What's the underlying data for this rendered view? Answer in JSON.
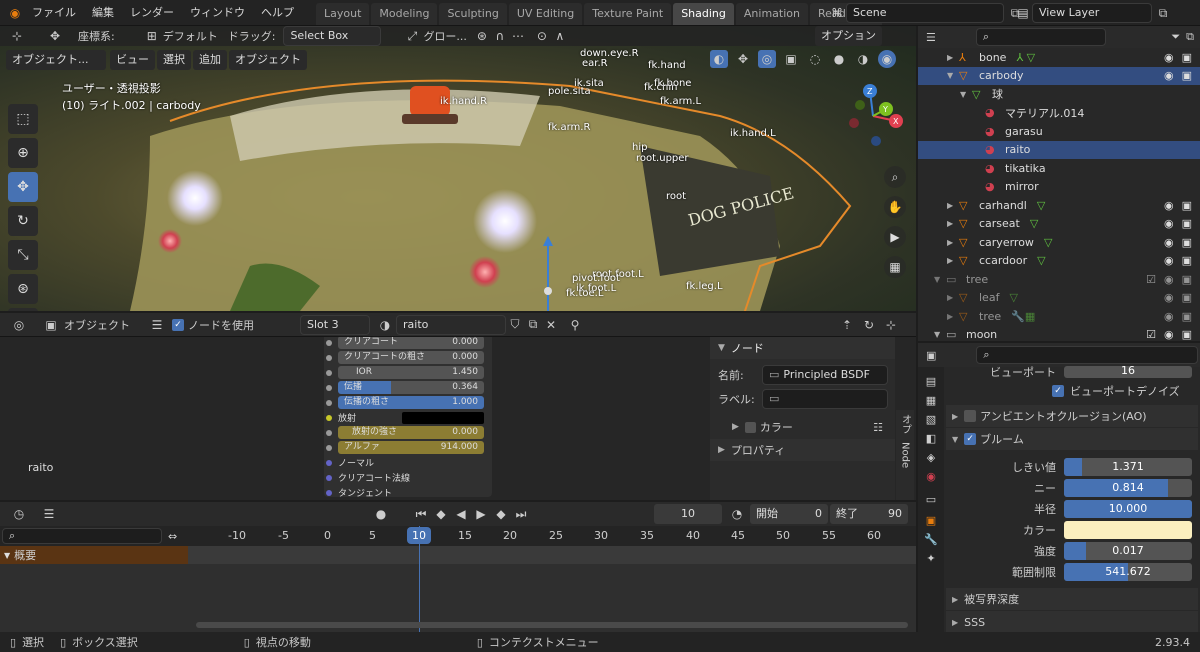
{
  "menu": [
    "ファイル",
    "編集",
    "レンダー",
    "ウィンドウ",
    "ヘルプ"
  ],
  "workspaces": [
    "Layout",
    "Modeling",
    "Sculpting",
    "UV Editing",
    "Texture Paint",
    "Shading",
    "Animation",
    "Rendering"
  ],
  "active_workspace": "Shading",
  "scene": "Scene",
  "view_layer": "View Layer",
  "viewport": {
    "coord_label": "座標系:",
    "coord_value": "デフォルト",
    "drag_label": "ドラッグ:",
    "drag_value": "Select Box",
    "global": "グロー...",
    "options": "オプション",
    "mode": "オブジェクト...",
    "menus": [
      "ビュー",
      "選択",
      "追加",
      "オブジェクト"
    ],
    "view_name": "ユーザー・透視投影",
    "info": "(10) ライト.002 | carbody",
    "bones": [
      "ik.hand.R",
      "pole.sita",
      "ik.sita",
      "fk.arm.R",
      "fk.arm.L",
      "ik.hand.L",
      "hip",
      "root.upper",
      "root",
      "down.eye.R",
      "ear.R",
      "fk.hand",
      "fk.chin",
      "fk.bone",
      "root.foot.L",
      "pivot.foot",
      "ik.foot.L",
      "fk.toe.L",
      "fk.leg.L"
    ],
    "decal": "DOG POLICE"
  },
  "node_editor": {
    "mode": "オブジェクト",
    "use_nodes": "ノードを使用",
    "slot": "Slot 3",
    "material": "raito",
    "frame_label": "raito",
    "rows": [
      {
        "label": "クリアコート",
        "value": "0.000",
        "kind": "gray"
      },
      {
        "label": "クリアコートの粗さ",
        "value": "0.000",
        "kind": "gray"
      },
      {
        "label": "IOR",
        "value": "1.450",
        "kind": "gray"
      },
      {
        "label": "伝播",
        "value": "0.364",
        "kind": "blue",
        "fill": 0.364
      },
      {
        "label": "伝播の粗さ",
        "value": "1.000",
        "kind": "blue",
        "fill": 1.0
      },
      {
        "label": "放射",
        "value": "",
        "kind": "color"
      },
      {
        "label": "放射の強さ",
        "value": "0.000",
        "kind": "gold"
      },
      {
        "label": "アルファ",
        "value": "914.000",
        "kind": "gold"
      },
      {
        "label": "ノーマル",
        "value": "",
        "kind": "socket"
      },
      {
        "label": "クリアコート法線",
        "value": "",
        "kind": "socket"
      },
      {
        "label": "タンジェント",
        "value": "",
        "kind": "socket"
      }
    ],
    "npanel": {
      "header": "ノード",
      "name_label": "名前:",
      "name_value": "Principled BSDF",
      "label_label": "ラベル:",
      "color": "カラー",
      "properties": "プロパティ",
      "tabs": [
        "オプ",
        "Node"
      ]
    }
  },
  "timeline": {
    "current": "10",
    "start_label": "開始",
    "start": "0",
    "end_label": "終了",
    "end": "90",
    "ticks": [
      "-10",
      "-5",
      "0",
      "5",
      "10",
      "15",
      "20",
      "25",
      "30",
      "35",
      "40",
      "45",
      "50",
      "55",
      "60"
    ],
    "summary": "概要"
  },
  "outliner": {
    "rows": [
      {
        "indent": 3,
        "name": "bone",
        "icon": "armature",
        "sel": false,
        "extra": "bone-icons"
      },
      {
        "indent": 3,
        "name": "carbody",
        "icon": "mesh",
        "sel": true,
        "extra": ""
      },
      {
        "indent": 4,
        "name": "球",
        "icon": "mesh-data",
        "sel": false,
        "extra": ""
      },
      {
        "indent": 5,
        "name": "マテリアル.014",
        "icon": "material",
        "sel": false,
        "extra": ""
      },
      {
        "indent": 5,
        "name": "garasu",
        "icon": "material",
        "sel": false,
        "extra": ""
      },
      {
        "indent": 5,
        "name": "raito",
        "icon": "material",
        "sel": true,
        "extra": ""
      },
      {
        "indent": 5,
        "name": "tikatika",
        "icon": "material",
        "sel": false,
        "extra": ""
      },
      {
        "indent": 5,
        "name": "mirror",
        "icon": "material",
        "sel": false,
        "extra": ""
      },
      {
        "indent": 3,
        "name": "carhandl",
        "icon": "mesh",
        "sel": false,
        "extra": "v"
      },
      {
        "indent": 3,
        "name": "carseat",
        "icon": "mesh",
        "sel": false,
        "extra": "v"
      },
      {
        "indent": 3,
        "name": "caryerrow",
        "icon": "mesh",
        "sel": false,
        "extra": "v"
      },
      {
        "indent": 3,
        "name": "ccardoor",
        "icon": "mesh",
        "sel": false,
        "extra": "v"
      },
      {
        "indent": 2,
        "name": "tree",
        "icon": "collection",
        "sel": false,
        "extra": "",
        "dim": true
      },
      {
        "indent": 3,
        "name": "leaf",
        "icon": "mesh",
        "sel": false,
        "extra": "v",
        "dim": true
      },
      {
        "indent": 3,
        "name": "tree",
        "icon": "mesh",
        "sel": false,
        "extra": "mods",
        "dim": true
      },
      {
        "indent": 2,
        "name": "moon",
        "icon": "collection",
        "sel": false,
        "extra": ""
      }
    ]
  },
  "properties": {
    "viewport_label": "ビューポート",
    "viewport_value": "16",
    "viewport_denoise": "ビューポートデノイズ",
    "ao": "アンビエントオクルージョン(AO)",
    "bloom": "ブルーム",
    "bloom_rows": [
      {
        "label": "しきい値",
        "value": "1.371",
        "fill": 0.14
      },
      {
        "label": "ニー",
        "value": "0.814",
        "fill": 0.81
      },
      {
        "label": "半径",
        "value": "10.000",
        "fill": 1.0
      },
      {
        "label": "強度",
        "value": "0.017",
        "fill": 0.17
      },
      {
        "label": "範囲制限",
        "value": "541.672",
        "fill": 0.5
      }
    ],
    "bloom_color_label": "カラー",
    "bloom_color": "#fbefbf",
    "dof": "被写界深度",
    "sss": "SSS"
  },
  "status": {
    "select": "選択",
    "box_select": "ボックス選択",
    "view_move": "視点の移動",
    "context_menu": "コンテクストメニュー",
    "version": "2.93.4"
  }
}
